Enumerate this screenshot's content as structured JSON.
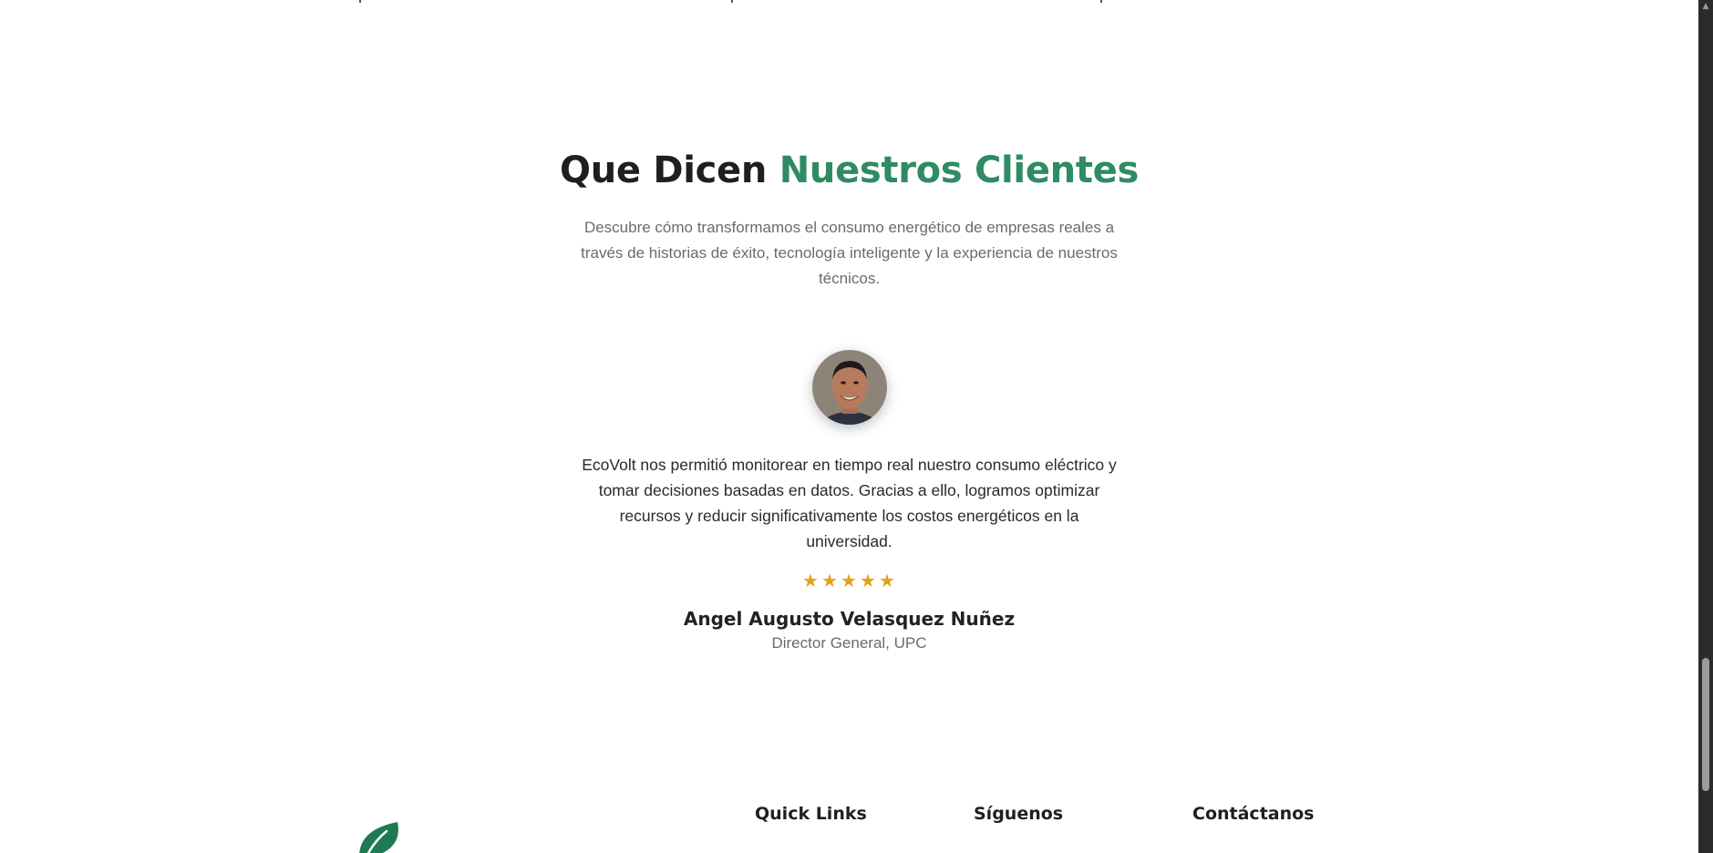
{
  "testimonials": {
    "title_part1": "Que Dicen",
    "title_part2": "Nuestros Clientes",
    "subtitle": "Descubre cómo transformamos el consumo energético de empresas reales a través de historias de éxito, tecnología inteligente y la experiencia de nuestros técnicos.",
    "quote": "EcoVolt nos permitió monitorear en tiempo real nuestro consumo eléctrico y tomar decisiones basadas en datos. Gracias a ello, logramos optimizar recursos y reducir significativamente los costos energéticos en la universidad.",
    "rating": 5,
    "star_glyph": "★",
    "author_name": "Angel Augusto Velasquez Nuñez",
    "author_role": "Director General, UPC",
    "colors": {
      "title_dark": "#1f1f1f",
      "title_green": "#2e8b63",
      "star": "#e0a21a"
    }
  },
  "footer": {
    "quick_links_heading": "Quick Links",
    "follow_heading": "Síguenos",
    "contact_heading": "Contáctanos",
    "logo_icon": "leaf-icon",
    "logo_color": "#1e7a52"
  },
  "scrollbar": {
    "up_arrow": "▲"
  }
}
